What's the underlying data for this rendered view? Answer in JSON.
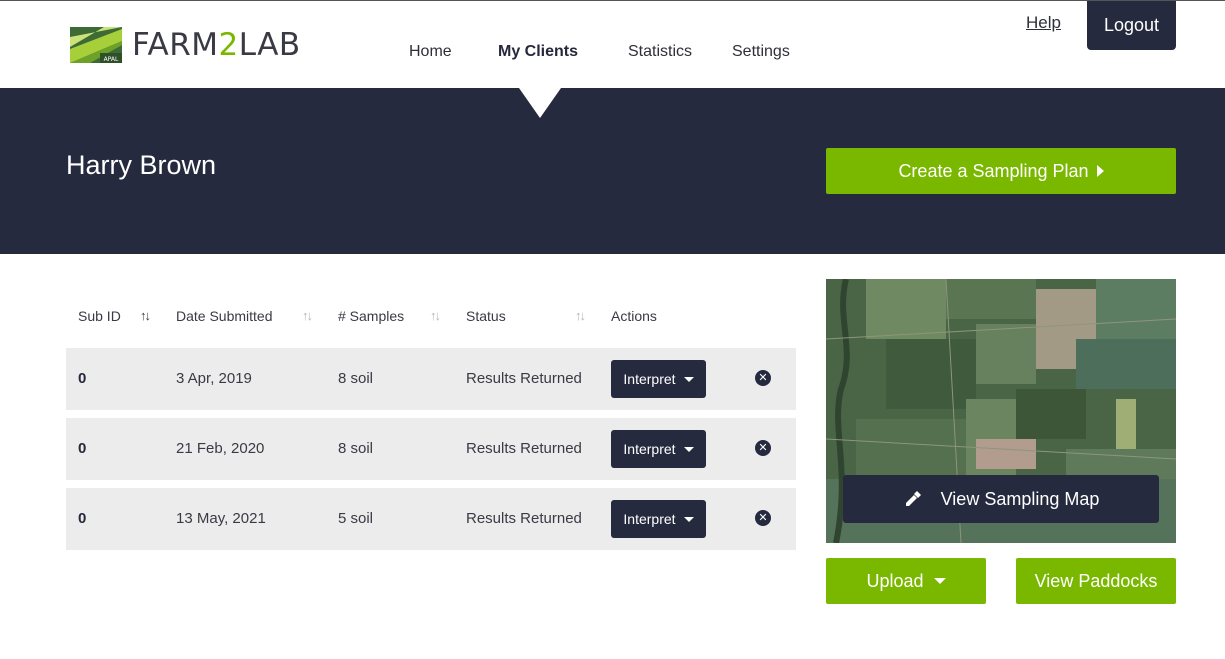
{
  "brand": {
    "mark_label": "APAL",
    "name_part1": "FARM",
    "name_part2": "2",
    "name_part3": "LAB",
    "accent_color": "#7ab800",
    "dark_color": "#262a3f"
  },
  "nav": {
    "items": [
      {
        "label": "Home"
      },
      {
        "label": "My Clients"
      },
      {
        "label": "Statistics"
      },
      {
        "label": "Settings"
      }
    ],
    "active": "My Clients",
    "help_label": "Help",
    "logout_label": "Logout"
  },
  "client": {
    "name": "Harry Brown",
    "create_plan_label": "Create a Sampling Plan"
  },
  "table": {
    "columns": [
      "Sub ID",
      "Date Submitted",
      "# Samples",
      "Status",
      "Actions"
    ],
    "sort_icon": "↑↓",
    "rows": [
      {
        "sub_id": "0",
        "date": "3 Apr, 2019",
        "samples": "8 soil",
        "status": "Results Returned",
        "action": "Interpret"
      },
      {
        "sub_id": "0",
        "date": "21 Feb, 2020",
        "samples": "8 soil",
        "status": "Results Returned",
        "action": "Interpret"
      },
      {
        "sub_id": "0",
        "date": "13 May, 2021",
        "samples": "5 soil",
        "status": "Results Returned",
        "action": "Interpret"
      }
    ]
  },
  "map_panel": {
    "view_map_label": "View Sampling Map",
    "upload_label": "Upload",
    "view_paddocks_label": "View Paddocks"
  }
}
